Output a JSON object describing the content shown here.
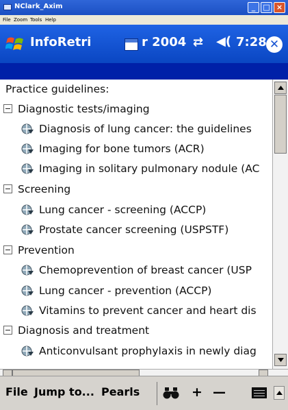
{
  "window": {
    "title": "NClark_Axim",
    "menu": [
      "File",
      "Zoom",
      "Tools",
      "Help"
    ],
    "buttons": {
      "minimize": "_",
      "maximize": "□",
      "close": "×"
    }
  },
  "navbar": {
    "app_title": "InfoRetri",
    "date": "r 2004",
    "connectivity_icon": "⇄",
    "speaker_icon": "◀(",
    "time": "7:28",
    "ok_label": "✕"
  },
  "tree": {
    "root_label": "Practice guidelines:",
    "groups": [
      {
        "label": "Diagnostic tests/imaging",
        "items": [
          "Diagnosis of lung cancer: the guidelines",
          "Imaging for bone tumors (ACR)",
          "Imaging in solitary pulmonary nodule (AC"
        ]
      },
      {
        "label": "Screening",
        "items": [
          "Lung cancer - screening (ACCP)",
          "Prostate cancer screening (USPSTF)"
        ]
      },
      {
        "label": "Prevention",
        "items": [
          "Chemoprevention of breast cancer (USP",
          "Lung cancer - prevention (ACCP)",
          "Vitamins to prevent cancer and heart dis"
        ]
      },
      {
        "label": "Diagnosis and treatment",
        "items": [
          "Anticonvulsant prophylaxis in newly diag"
        ]
      }
    ]
  },
  "cmdbar": {
    "file": "File",
    "jump": "Jump to...",
    "pearls": "Pearls",
    "find_icon": "binoculars-icon",
    "zoom_in": "+",
    "zoom_out": "—"
  },
  "colors": {
    "nav_blue": "#1854d2",
    "dark_band": "#0020a8",
    "command_bar": "#d6d3ce"
  }
}
